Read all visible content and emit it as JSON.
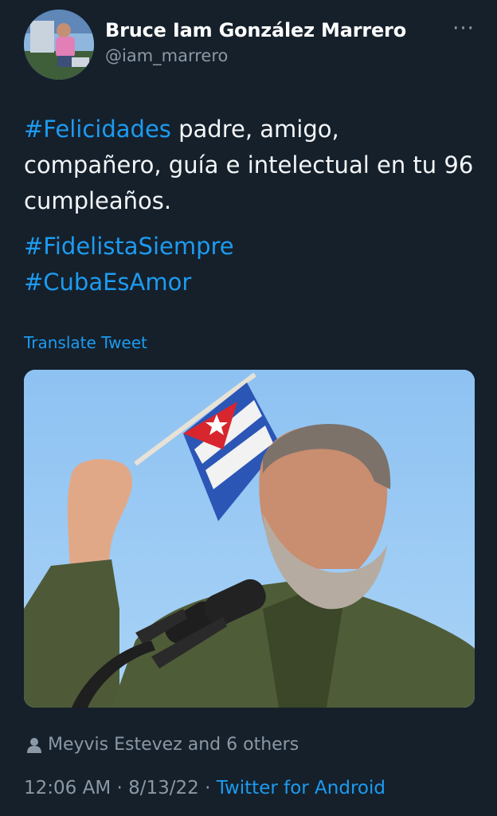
{
  "author": {
    "display_name": "Bruce Iam González Marrero",
    "handle": "@iam_marrero"
  },
  "menu": {
    "more_icon": "more-horizontal-icon",
    "more_glyph": "···"
  },
  "tweet": {
    "line1_hashtag": "#Felicidades",
    "line1_rest": " padre, amigo, compañero, guía e intelectual en tu 96 cumpleaños.",
    "hashtag2": "#FidelistaSiempre",
    "hashtag3": "#CubaEsAmor"
  },
  "translate_label": "Translate Tweet",
  "social_context": {
    "icon": "person-icon",
    "text": "Meyvis Estevez and 6 others"
  },
  "meta": {
    "time": "12:06 AM",
    "separator": " · ",
    "date": "8/13/22",
    "source": "Twitter for Android"
  },
  "colors": {
    "background": "#15202b",
    "link": "#1d9bf0",
    "secondary_text": "#8b98a5"
  }
}
